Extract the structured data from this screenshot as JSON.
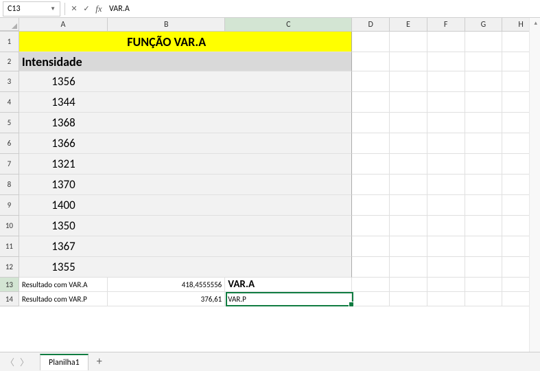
{
  "name_box": "C13",
  "formula": "VAR.A",
  "columns": [
    "A",
    "B",
    "C",
    "D",
    "E",
    "F",
    "G",
    "H"
  ],
  "title": "FUNÇÃO VAR.A",
  "header": "Intensidade",
  "data_rows": [
    "1356",
    "1344",
    "1368",
    "1366",
    "1321",
    "1370",
    "1400",
    "1350",
    "1367",
    "1355"
  ],
  "result1_label": "Resultado com VAR.A",
  "result1_value": "418,4555556",
  "result1_c": "VAR.A",
  "result2_label": "Resultado com VAR.P",
  "result2_value": "376,61",
  "result2_c": "VAR.P",
  "sheet_tab": "Planilha1"
}
